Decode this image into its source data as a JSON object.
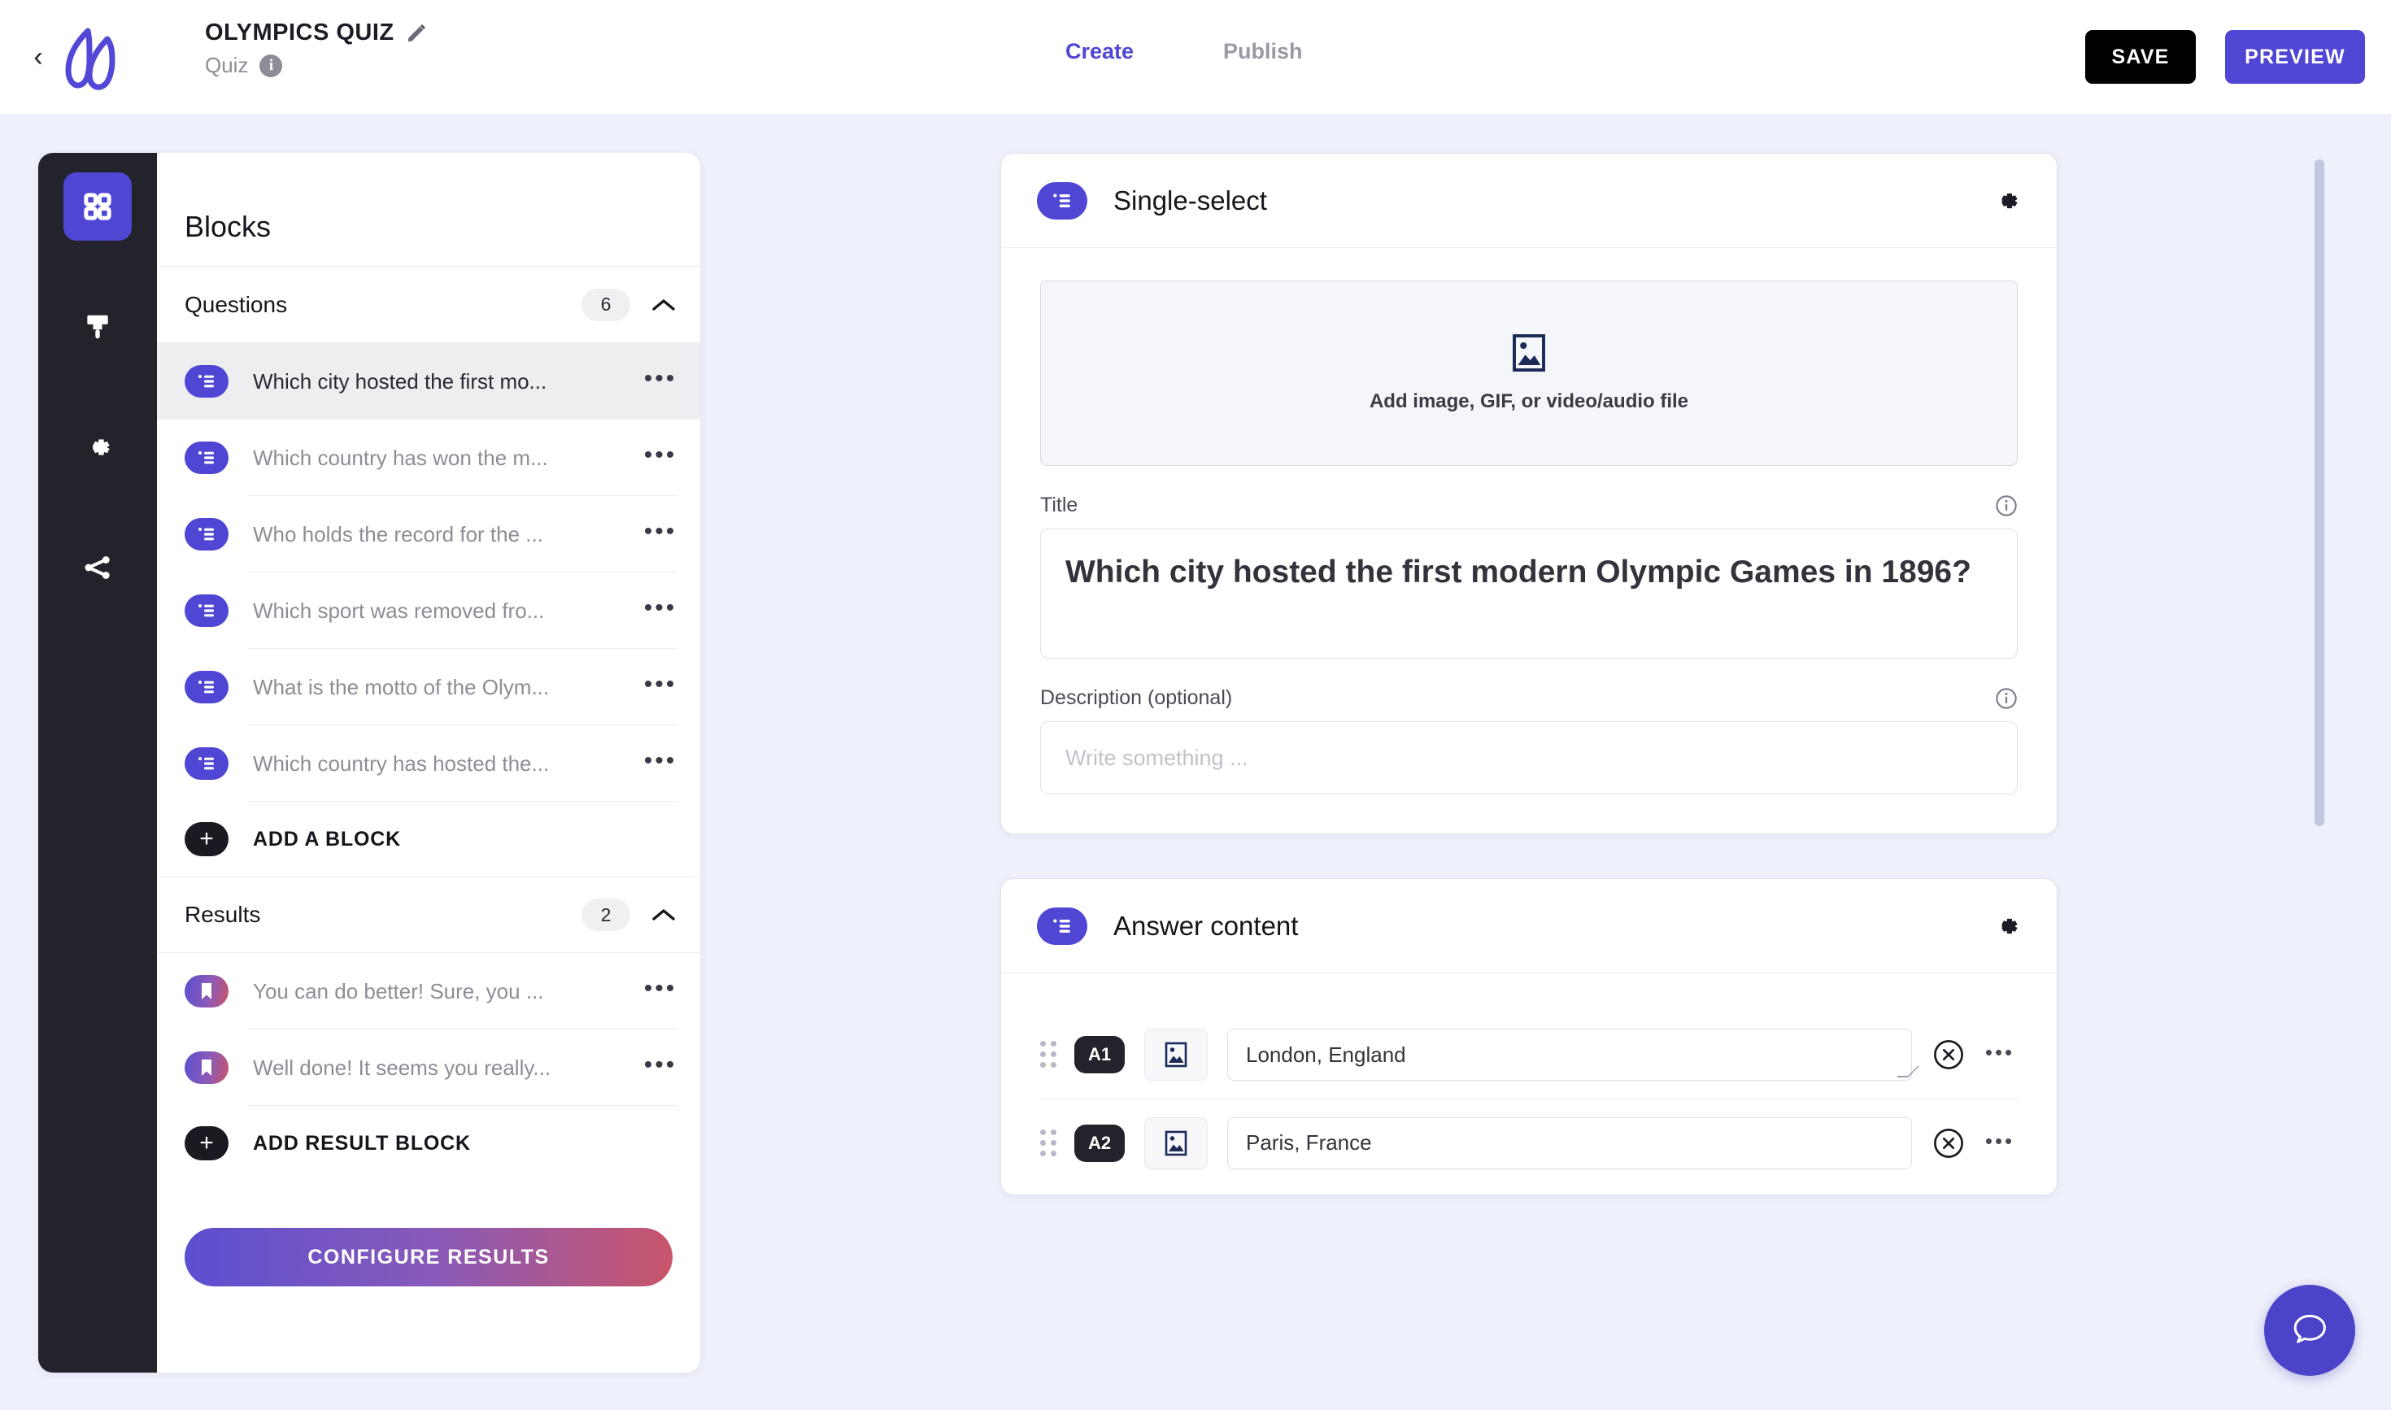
{
  "header": {
    "back_icon": "chevron-left-icon",
    "logo_icon": "app-logo-icon",
    "quiz_title": "OLYMPICS QUIZ",
    "edit_icon": "pencil-icon",
    "subtitle": "Quiz",
    "info_icon": "info-icon",
    "info_glyph": "i",
    "tabs": [
      {
        "label": "Create",
        "active": true
      },
      {
        "label": "Publish",
        "active": false
      }
    ],
    "save_label": "SAVE",
    "preview_label": "PREVIEW"
  },
  "rail": {
    "items": [
      {
        "name": "blocks",
        "icon": "grid-icon",
        "active": true
      },
      {
        "name": "design",
        "icon": "paintbrush-icon",
        "active": false
      },
      {
        "name": "settings",
        "icon": "gear-icon",
        "active": false
      },
      {
        "name": "share",
        "icon": "share-icon",
        "active": false
      }
    ]
  },
  "blocks_panel": {
    "heading": "Blocks",
    "questions": {
      "title": "Questions",
      "count": "6",
      "collapse_icon": "chevron-up-icon",
      "items": [
        {
          "label": "Which city hosted the first mo...",
          "selected": true
        },
        {
          "label": "Which country has won the m...",
          "selected": false
        },
        {
          "label": "Who holds the record for the ...",
          "selected": false
        },
        {
          "label": "Which sport was removed fro...",
          "selected": false
        },
        {
          "label": "What is the motto of the Olym...",
          "selected": false
        },
        {
          "label": "Which country has hosted the...",
          "selected": false
        }
      ],
      "add_label": "ADD A BLOCK"
    },
    "results": {
      "title": "Results",
      "count": "2",
      "collapse_icon": "chevron-up-icon",
      "items": [
        {
          "label": "You can do better! Sure, you ..."
        },
        {
          "label": "Well done! It seems you really..."
        }
      ],
      "add_label": "ADD RESULT BLOCK",
      "configure_label": "CONFIGURE RESULTS"
    }
  },
  "question_card": {
    "type_label": "Single-select",
    "type_icon": "list-icon",
    "settings_icon": "gear-icon",
    "media_drop_label": "Add image, GIF, or video/audio file",
    "media_icon": "image-icon",
    "title_field": {
      "label": "Title",
      "info_icon": "info-outline-icon",
      "value": "Which city hosted the first modern Olympic Games in 1896?"
    },
    "description_field": {
      "label": "Description (optional)",
      "info_icon": "info-outline-icon",
      "value": "",
      "placeholder": "Write something ..."
    }
  },
  "answer_card": {
    "type_label": "Answer content",
    "type_icon": "list-icon",
    "settings_icon": "gear-icon",
    "rows": [
      {
        "key": "A1",
        "value": "London, England",
        "image_icon": "image-icon",
        "clear_icon": "clear-circle-icon",
        "menu_icon": "more-horizontal-icon"
      },
      {
        "key": "A2",
        "value": "Paris, France",
        "image_icon": "image-icon",
        "clear_icon": "clear-circle-icon",
        "menu_icon": "more-horizontal-icon"
      }
    ]
  },
  "chat_fab": {
    "icon": "chat-bubble-icon"
  },
  "colors": {
    "accent_purple": "#4f46d4",
    "rail_dark": "#23232c",
    "page_background": "#eef0fb",
    "result_gradient_start": "#5b4fd0",
    "result_gradient_end": "#c9556a"
  }
}
